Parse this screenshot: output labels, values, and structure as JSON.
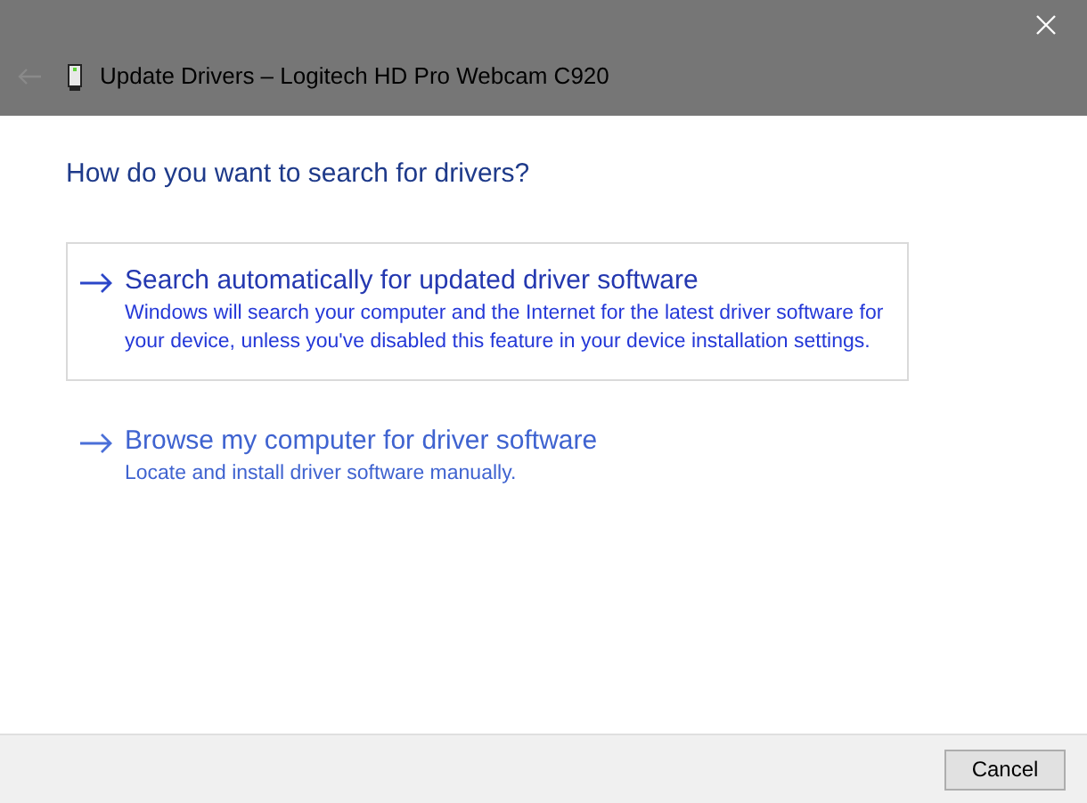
{
  "window": {
    "title": "Update Drivers – Logitech HD Pro Webcam C920"
  },
  "heading": "How do you want to search for drivers?",
  "options": [
    {
      "title": "Search automatically for updated driver software",
      "description": "Windows will search your computer and the Internet for the latest driver software for your device, unless you've disabled this feature in your device installation settings.",
      "selected": true
    },
    {
      "title": "Browse my computer for driver software",
      "description": "Locate and install driver software manually.",
      "selected": false
    }
  ],
  "buttons": [
    "Cancel"
  ]
}
